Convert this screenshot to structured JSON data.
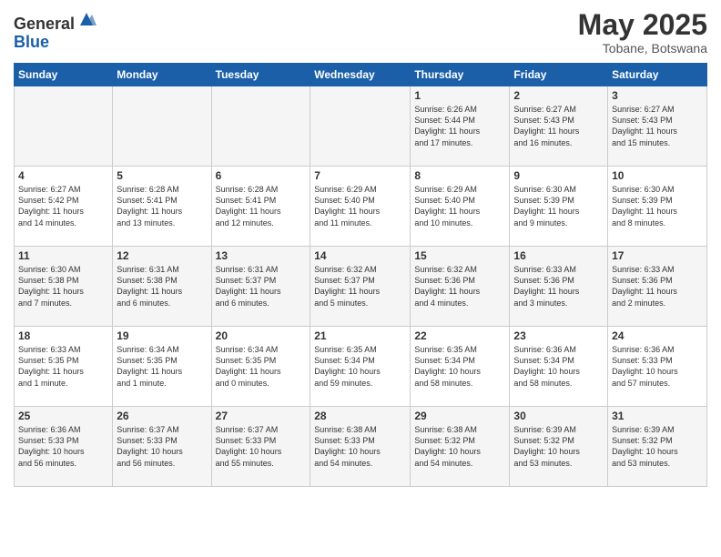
{
  "header": {
    "logo_general": "General",
    "logo_blue": "Blue",
    "month_title": "May 2025",
    "location": "Tobane, Botswana"
  },
  "days_of_week": [
    "Sunday",
    "Monday",
    "Tuesday",
    "Wednesday",
    "Thursday",
    "Friday",
    "Saturday"
  ],
  "weeks": [
    [
      {
        "day": "",
        "info": ""
      },
      {
        "day": "",
        "info": ""
      },
      {
        "day": "",
        "info": ""
      },
      {
        "day": "",
        "info": ""
      },
      {
        "day": "1",
        "info": "Sunrise: 6:26 AM\nSunset: 5:44 PM\nDaylight: 11 hours\nand 17 minutes."
      },
      {
        "day": "2",
        "info": "Sunrise: 6:27 AM\nSunset: 5:43 PM\nDaylight: 11 hours\nand 16 minutes."
      },
      {
        "day": "3",
        "info": "Sunrise: 6:27 AM\nSunset: 5:43 PM\nDaylight: 11 hours\nand 15 minutes."
      }
    ],
    [
      {
        "day": "4",
        "info": "Sunrise: 6:27 AM\nSunset: 5:42 PM\nDaylight: 11 hours\nand 14 minutes."
      },
      {
        "day": "5",
        "info": "Sunrise: 6:28 AM\nSunset: 5:41 PM\nDaylight: 11 hours\nand 13 minutes."
      },
      {
        "day": "6",
        "info": "Sunrise: 6:28 AM\nSunset: 5:41 PM\nDaylight: 11 hours\nand 12 minutes."
      },
      {
        "day": "7",
        "info": "Sunrise: 6:29 AM\nSunset: 5:40 PM\nDaylight: 11 hours\nand 11 minutes."
      },
      {
        "day": "8",
        "info": "Sunrise: 6:29 AM\nSunset: 5:40 PM\nDaylight: 11 hours\nand 10 minutes."
      },
      {
        "day": "9",
        "info": "Sunrise: 6:30 AM\nSunset: 5:39 PM\nDaylight: 11 hours\nand 9 minutes."
      },
      {
        "day": "10",
        "info": "Sunrise: 6:30 AM\nSunset: 5:39 PM\nDaylight: 11 hours\nand 8 minutes."
      }
    ],
    [
      {
        "day": "11",
        "info": "Sunrise: 6:30 AM\nSunset: 5:38 PM\nDaylight: 11 hours\nand 7 minutes."
      },
      {
        "day": "12",
        "info": "Sunrise: 6:31 AM\nSunset: 5:38 PM\nDaylight: 11 hours\nand 6 minutes."
      },
      {
        "day": "13",
        "info": "Sunrise: 6:31 AM\nSunset: 5:37 PM\nDaylight: 11 hours\nand 6 minutes."
      },
      {
        "day": "14",
        "info": "Sunrise: 6:32 AM\nSunset: 5:37 PM\nDaylight: 11 hours\nand 5 minutes."
      },
      {
        "day": "15",
        "info": "Sunrise: 6:32 AM\nSunset: 5:36 PM\nDaylight: 11 hours\nand 4 minutes."
      },
      {
        "day": "16",
        "info": "Sunrise: 6:33 AM\nSunset: 5:36 PM\nDaylight: 11 hours\nand 3 minutes."
      },
      {
        "day": "17",
        "info": "Sunrise: 6:33 AM\nSunset: 5:36 PM\nDaylight: 11 hours\nand 2 minutes."
      }
    ],
    [
      {
        "day": "18",
        "info": "Sunrise: 6:33 AM\nSunset: 5:35 PM\nDaylight: 11 hours\nand 1 minute."
      },
      {
        "day": "19",
        "info": "Sunrise: 6:34 AM\nSunset: 5:35 PM\nDaylight: 11 hours\nand 1 minute."
      },
      {
        "day": "20",
        "info": "Sunrise: 6:34 AM\nSunset: 5:35 PM\nDaylight: 11 hours\nand 0 minutes."
      },
      {
        "day": "21",
        "info": "Sunrise: 6:35 AM\nSunset: 5:34 PM\nDaylight: 10 hours\nand 59 minutes."
      },
      {
        "day": "22",
        "info": "Sunrise: 6:35 AM\nSunset: 5:34 PM\nDaylight: 10 hours\nand 58 minutes."
      },
      {
        "day": "23",
        "info": "Sunrise: 6:36 AM\nSunset: 5:34 PM\nDaylight: 10 hours\nand 58 minutes."
      },
      {
        "day": "24",
        "info": "Sunrise: 6:36 AM\nSunset: 5:33 PM\nDaylight: 10 hours\nand 57 minutes."
      }
    ],
    [
      {
        "day": "25",
        "info": "Sunrise: 6:36 AM\nSunset: 5:33 PM\nDaylight: 10 hours\nand 56 minutes."
      },
      {
        "day": "26",
        "info": "Sunrise: 6:37 AM\nSunset: 5:33 PM\nDaylight: 10 hours\nand 56 minutes."
      },
      {
        "day": "27",
        "info": "Sunrise: 6:37 AM\nSunset: 5:33 PM\nDaylight: 10 hours\nand 55 minutes."
      },
      {
        "day": "28",
        "info": "Sunrise: 6:38 AM\nSunset: 5:33 PM\nDaylight: 10 hours\nand 54 minutes."
      },
      {
        "day": "29",
        "info": "Sunrise: 6:38 AM\nSunset: 5:32 PM\nDaylight: 10 hours\nand 54 minutes."
      },
      {
        "day": "30",
        "info": "Sunrise: 6:39 AM\nSunset: 5:32 PM\nDaylight: 10 hours\nand 53 minutes."
      },
      {
        "day": "31",
        "info": "Sunrise: 6:39 AM\nSunset: 5:32 PM\nDaylight: 10 hours\nand 53 minutes."
      }
    ]
  ]
}
